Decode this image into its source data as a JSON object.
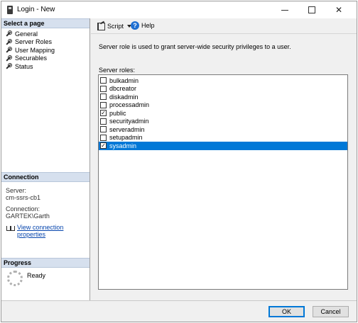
{
  "window": {
    "title": "Login - New"
  },
  "sidebar": {
    "select_page_header": "Select a page",
    "items": [
      {
        "label": "General"
      },
      {
        "label": "Server Roles"
      },
      {
        "label": "User Mapping"
      },
      {
        "label": "Securables"
      },
      {
        "label": "Status"
      }
    ]
  },
  "connection": {
    "header": "Connection",
    "server_label": "Server:",
    "server_value": "cm-ssrs-cb1",
    "connection_label": "Connection:",
    "connection_value": "GARTEK\\Garth",
    "view_link": "View connection properties"
  },
  "progress": {
    "header": "Progress",
    "status": "Ready"
  },
  "toolbar": {
    "script_label": "Script",
    "help_label": "Help"
  },
  "main": {
    "description": "Server role is used to grant server-wide security privileges to a user.",
    "roles_label": "Server roles:",
    "roles": [
      {
        "name": "bulkadmin",
        "checked": false
      },
      {
        "name": "dbcreator",
        "checked": false
      },
      {
        "name": "diskadmin",
        "checked": false
      },
      {
        "name": "processadmin",
        "checked": false
      },
      {
        "name": "public",
        "checked": true
      },
      {
        "name": "securityadmin",
        "checked": false
      },
      {
        "name": "serveradmin",
        "checked": false
      },
      {
        "name": "setupadmin",
        "checked": false
      },
      {
        "name": "sysadmin",
        "checked": true,
        "selected": true
      }
    ]
  },
  "buttons": {
    "ok": "OK",
    "cancel": "Cancel"
  },
  "colors": {
    "selection": "#0078d7",
    "section_header": "#d6e0ee",
    "link": "#0645ad"
  }
}
